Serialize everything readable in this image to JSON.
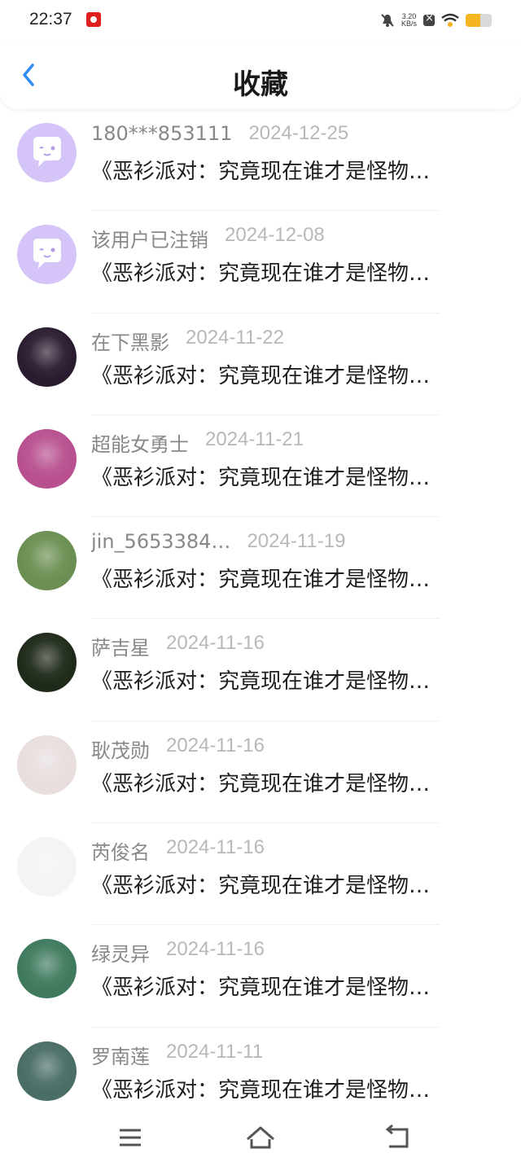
{
  "status": {
    "time": "22:37",
    "speed_value": "3.20",
    "speed_unit": "KB/s",
    "battery_level": 0.55
  },
  "header": {
    "title": "收藏"
  },
  "items": [
    {
      "user": "180***853111",
      "date": "2024-12-25",
      "text": "《恶衫派对：究竟现在谁才是怪物…",
      "avatar": "default-chat-avatar"
    },
    {
      "user": "该用户已注销",
      "date": "2024-12-08",
      "text": "《恶衫派对：究竟现在谁才是怪物…",
      "avatar": "default-chat-avatar"
    },
    {
      "user": "在下黑影",
      "date": "2024-11-22",
      "text": "《恶衫派对：究竟现在谁才是怪物…",
      "avatar": "photo"
    },
    {
      "user": "超能女勇士",
      "date": "2024-11-21",
      "text": "《恶衫派对：究竟现在谁才是怪物…",
      "avatar": "photo"
    },
    {
      "user": "jin_5653384…",
      "date": "2024-11-19",
      "text": "《恶衫派对：究竟现在谁才是怪物…",
      "avatar": "photo"
    },
    {
      "user": "萨吉星",
      "date": "2024-11-16",
      "text": "《恶衫派对：究竟现在谁才是怪物…",
      "avatar": "photo"
    },
    {
      "user": "耿茂勋",
      "date": "2024-11-16",
      "text": "《恶衫派对：究竟现在谁才是怪物…",
      "avatar": "photo"
    },
    {
      "user": "芮俊名",
      "date": "2024-11-16",
      "text": "《恶衫派对：究竟现在谁才是怪物…",
      "avatar": "photo"
    },
    {
      "user": "绿灵异",
      "date": "2024-11-16",
      "text": "《恶衫派对：究竟现在谁才是怪物…",
      "avatar": "photo"
    },
    {
      "user": "罗南莲",
      "date": "2024-11-11",
      "text": "《恶衫派对：究竟现在谁才是怪物…",
      "avatar": "photo"
    }
  ],
  "colors": {
    "accent": "#2f8ef5",
    "default_avatar_bg": "#d4c4f7",
    "photo_avatar_bgs": [
      "#2a1c30",
      "#b8508f",
      "#6b8f52",
      "#1f2a1a",
      "#e8dede",
      "#f4f4f4",
      "#3f7a5e",
      "#4a6d66"
    ]
  }
}
